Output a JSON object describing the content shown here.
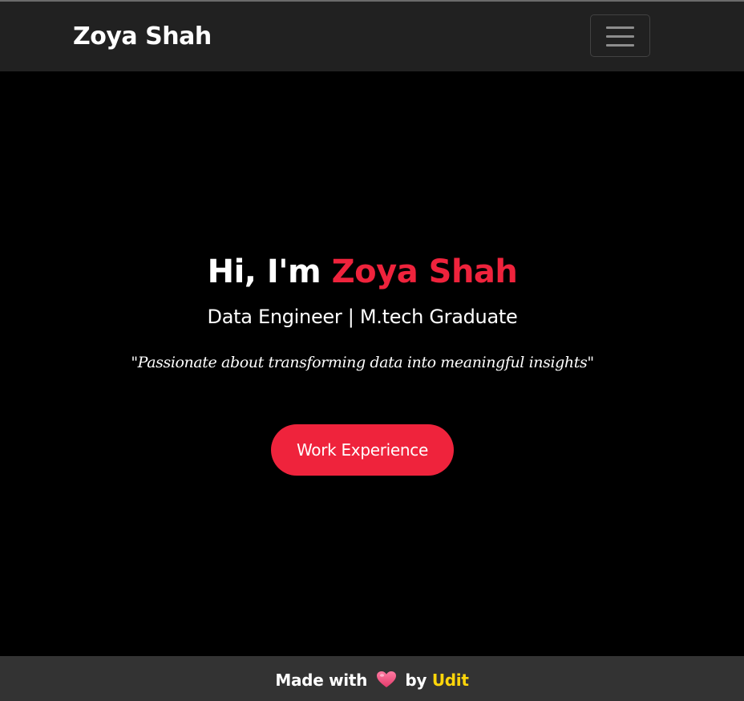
{
  "navbar": {
    "brand": "Zoya Shah",
    "toggler_icon": "hamburger-menu-icon"
  },
  "hero": {
    "greeting": "Hi, I'm",
    "name": "Zoya Shah",
    "subtitle": "Data Engineer | M.tech Graduate",
    "quote": "\"Passionate about transforming data into meaningful insights\"",
    "cta_label": "Work Experience"
  },
  "footer": {
    "made_with": "Made with",
    "heart_icon": "heart-icon",
    "by": "by",
    "author": "Udit"
  },
  "colors": {
    "accent": "#ef233c",
    "navbar_bg": "#212121",
    "hero_bg": "#000000",
    "footer_bg": "#333333",
    "author": "#ffd60a",
    "heart": "#f2557d"
  }
}
